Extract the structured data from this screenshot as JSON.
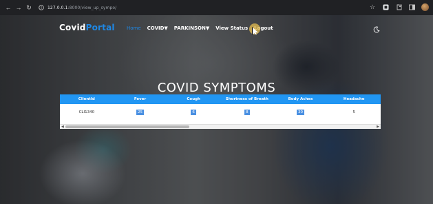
{
  "browser": {
    "url_host": "127.0.0.1",
    "url_path": ":8000/view_up_sympo/"
  },
  "header": {
    "brand_main": "Covid",
    "brand_accent": "Portal",
    "nav": [
      {
        "label": "Home"
      },
      {
        "label": "COVID▼"
      },
      {
        "label": "PARKINSON▼"
      },
      {
        "label": "View Status"
      },
      {
        "label": "Logout"
      }
    ]
  },
  "page_title": "COVID SYMPTOMS",
  "table": {
    "columns": [
      "ClientId",
      "Fever",
      "Cough",
      "Shortness of Breath",
      "Body Aches",
      "Headache"
    ],
    "rows": [
      [
        "CLI1340",
        "25",
        "6",
        "8",
        "30",
        "5"
      ]
    ]
  },
  "colors": {
    "accent": "#1e88e5",
    "table_header": "#2196f3"
  }
}
